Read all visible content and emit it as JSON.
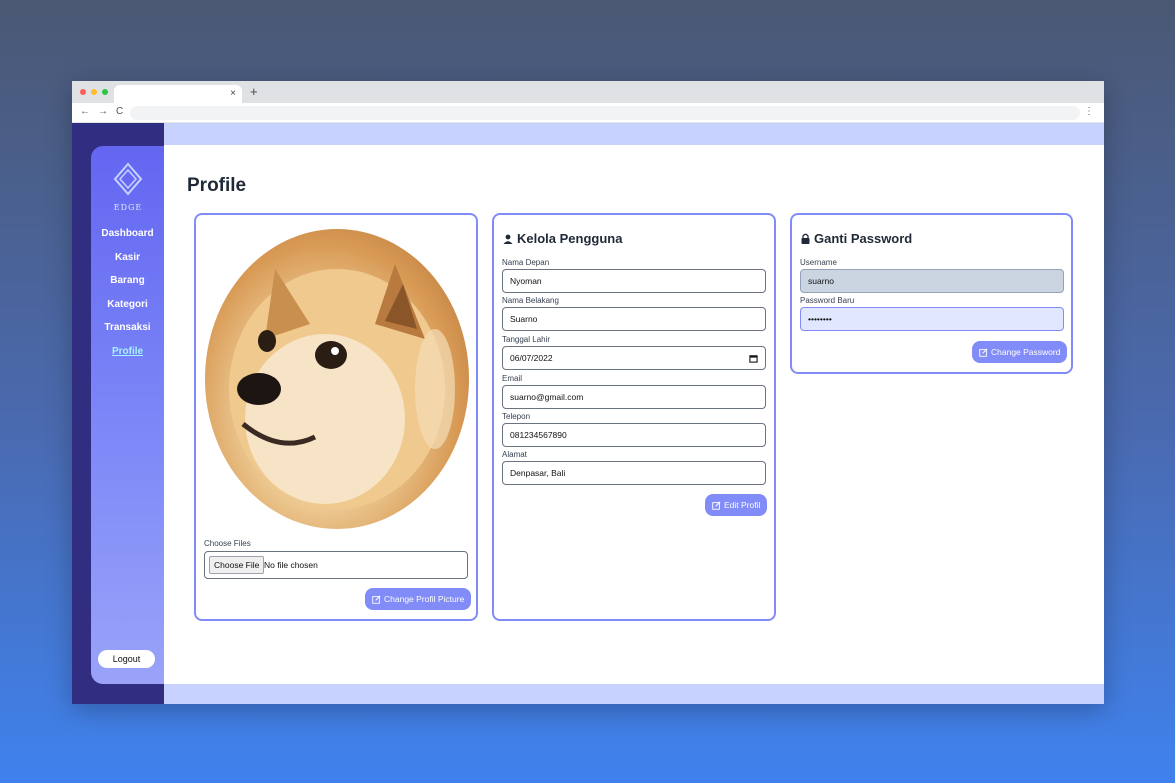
{
  "browser": {
    "tab_close": "×",
    "new_tab": "+",
    "nav_back": "←",
    "nav_forward": "→",
    "nav_reload": "C",
    "menu": "⋮"
  },
  "sidebar": {
    "logo_text": "EDGE",
    "items": [
      {
        "label": "Dashboard"
      },
      {
        "label": "Kasir"
      },
      {
        "label": "Barang"
      },
      {
        "label": "Kategori"
      },
      {
        "label": "Transaksi"
      },
      {
        "label": "Profile",
        "active": true
      }
    ],
    "logout": "Logout"
  },
  "page": {
    "title": "Profile"
  },
  "picture_card": {
    "choose_label": "Choose Files",
    "file_button": "Choose File",
    "file_status": "No file chosen",
    "submit": "Change Profil Picture"
  },
  "user_card": {
    "title": "Kelola Pengguna",
    "fields": [
      {
        "label": "Nama Depan",
        "value": "Nyoman"
      },
      {
        "label": "Nama Belakang",
        "value": "Suarno"
      },
      {
        "label": "Tanggal Lahir",
        "value": "06/07/2022"
      },
      {
        "label": "Email",
        "value": "suarno@gmail.com"
      },
      {
        "label": "Telepon",
        "value": "081234567890"
      },
      {
        "label": "Alamat",
        "value": "Denpasar, Bali"
      }
    ],
    "submit": "Edit Profil"
  },
  "password_card": {
    "title": "Ganti Password",
    "username_label": "Username",
    "username_value": "suarno",
    "password_label": "Password Baru",
    "password_value": "••••••••",
    "submit": "Change Password"
  },
  "colors": {
    "accent": "#818cf8",
    "sidebar_dark": "#312e81",
    "band": "#c7d2fe",
    "active_link": "#a5f3fc"
  }
}
